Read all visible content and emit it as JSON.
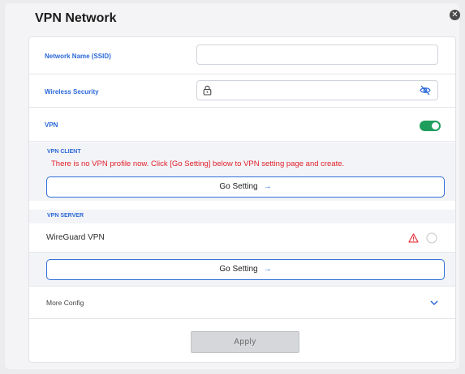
{
  "dialog": {
    "title": "VPN Network"
  },
  "fields": {
    "ssid_label": "Network Name (SSID)",
    "ssid_value": "",
    "security_label": "Wireless Security",
    "security_value": "",
    "vpn_label": "VPN",
    "vpn_enabled": true
  },
  "vpn_client": {
    "title": "VPN CLIENT",
    "message": "There is no VPN profile now. Click [Go Setting] below to VPN setting page and create.",
    "go_setting_label": "Go Setting",
    "arrow": "→"
  },
  "vpn_server": {
    "title": "VPN SERVER",
    "item_label": "WireGuard VPN",
    "go_setting_label": "Go Setting",
    "arrow": "→"
  },
  "more_config": {
    "label": "More Config"
  },
  "apply": {
    "label": "Apply"
  },
  "colors": {
    "accent": "#2b68d9",
    "toggle_on": "#1f9d5c",
    "warning": "#e0202a"
  }
}
